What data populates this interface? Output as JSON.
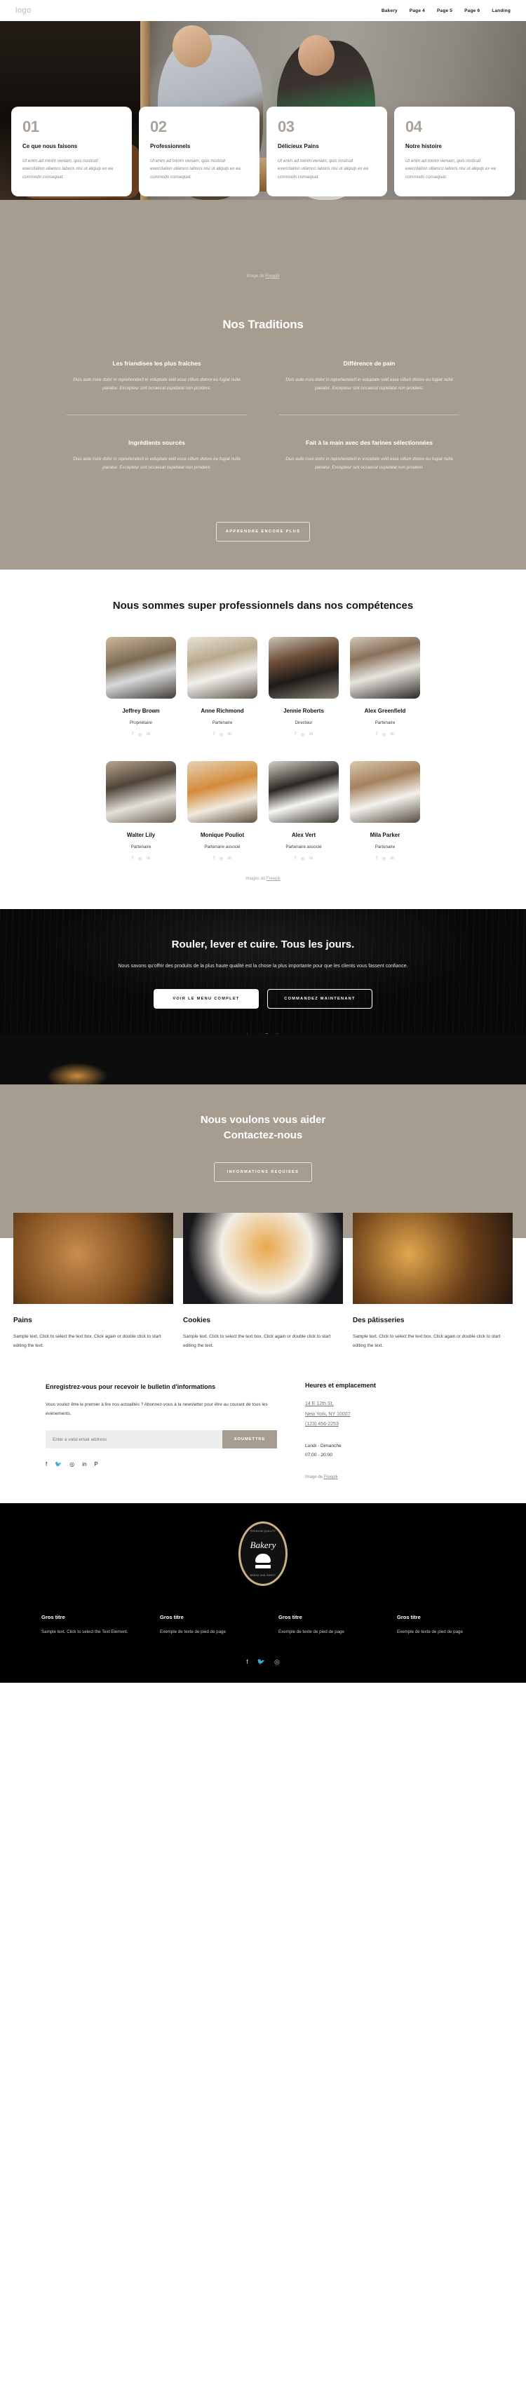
{
  "header": {
    "logo": "logo",
    "nav": [
      {
        "label": "Bakery"
      },
      {
        "label": "Page 4"
      },
      {
        "label": "Page 5"
      },
      {
        "label": "Page 6"
      },
      {
        "label": "Landing"
      }
    ]
  },
  "info_cards": [
    {
      "num": "01",
      "title": "Ce que nous faisons",
      "desc": "Ut enim ad minim veniam, quis nostrud exercitation ullamco laboris nisi ut aliquip ex ea commodo consequat."
    },
    {
      "num": "02",
      "title": "Professionnels",
      "desc": "Ut enim ad minim veniam, quis nostrud exercitation ullamco laboris nisi ut aliquip ex ea commodo consequat."
    },
    {
      "num": "03",
      "title": "Délicieux Pains",
      "desc": "Ut enim ad minim veniam, quis nostrud exercitation ullamco laboris nisi ut aliquip ex ea commodo consequat."
    },
    {
      "num": "04",
      "title": "Notre histoire",
      "desc": "Ut enim ad minim veniam, quis nostrud exercitation ullamco laboris nisi ut aliquip ex ea commodo consequat."
    }
  ],
  "credits": {
    "prefix": "Image de ",
    "link": "Freepik",
    "plural_prefix": "Images de "
  },
  "traditions": {
    "title": "Nos Traditions",
    "items": [
      {
        "title": "Les friandises les plus fraîches",
        "desc": "Duis aute irure dolor in reprehenderit in voluptate velit esse cillum dolore eu fugiat nulla pariatur. Excepteur sint occaecat cupidatat non proident."
      },
      {
        "title": "Différence de pain",
        "desc": "Duis aute irure dolor in reprehenderit in voluptate velit esse cillum dolore eu fugiat nulla pariatur. Excepteur sint occaecat cupidatat non proident."
      },
      {
        "title": "Ingrédients sourcés",
        "desc": "Duis aute irure dolor in reprehenderit in voluptate velit esse cillum dolore eu fugiat nulla pariatur. Excepteur sint occaecat cupidatat non proident."
      },
      {
        "title": "Fait à la main avec des farines sélectionnées",
        "desc": "Duis aute irure dolor in reprehenderit in voluptate velit esse cillum dolore eu fugiat nulla pariatur. Excepteur sint occaecat cupidatat non proident."
      }
    ],
    "button": "APPRENDRE ENCORE PLUS"
  },
  "team": {
    "title": "Nous sommes super professionnels dans nos compétences",
    "members": [
      {
        "name": "Jeffrey Brown",
        "role": "Propriétaire"
      },
      {
        "name": "Anne Richmond",
        "role": "Partenaire"
      },
      {
        "name": "Jennie Roberts",
        "role": "Directeur"
      },
      {
        "name": "Alex Greenfield",
        "role": "Partenaire"
      },
      {
        "name": "Walter Lily",
        "role": "Partenaire"
      },
      {
        "name": "Monique Pouliot",
        "role": "Partenaire associé"
      },
      {
        "name": "Alex Vert",
        "role": "Partenaire associé"
      },
      {
        "name": "Mila Parker",
        "role": "Partenaire"
      }
    ],
    "social_icons": [
      "facebook-icon",
      "instagram-icon",
      "linkedin-icon"
    ]
  },
  "cta": {
    "title": "Rouler, lever et cuire. Tous les jours.",
    "text": "Nous savons qu'offrir des produits de la plus haute qualité est la chose la plus importante pour que les clients vous fassent confiance.",
    "primary_button": "VOIR LE MENU COMPLET",
    "secondary_button": "COMMANDEZ MAINTENANT"
  },
  "contact": {
    "line1": "Nous voulons vous aider",
    "line2": "Contactez-nous",
    "button": "INFORMATIONS REQUISES"
  },
  "products": [
    {
      "title": "Pains",
      "text": "Sample text. Click to select the text box. Click again or double click to start editing the text."
    },
    {
      "title": "Cookies",
      "text": "Sample text. Click to select the text box. Click again or double click to start editing the text."
    },
    {
      "title": "Des pâtisseries",
      "text": "Sample text. Click to select the text box. Click again or double click to start editing the text."
    }
  ],
  "newsletter": {
    "title": "Enregistrez-vous pour recevoir le bulletin d'informations",
    "text": "Vous voulez être le premier à lire nos actualités ? Abonnez-vous à la newsletter pour être au courant de tous les événements.",
    "placeholder": "Enter a valid email address",
    "submit": "SOUMETTRE",
    "social_icons": [
      "facebook-icon",
      "twitter-icon",
      "instagram-icon",
      "linkedin-icon",
      "pinterest-icon"
    ]
  },
  "hours": {
    "title": "Heures et emplacement",
    "address_line1": "14 E 12th St,",
    "address_line2": "New York, NY 10007",
    "phone": "(123) 456-2253",
    "days": "Lundi - Dimanche",
    "time": "07:00 - 20:00"
  },
  "footer": {
    "badge": {
      "top_text": "PREMIUM QUALITY",
      "name": "Bakery",
      "mid_text": "SINCE 1930",
      "bottom_text": "BREAD AND SWEET"
    },
    "columns": [
      {
        "title": "Gros titre",
        "text": "Sample text. Click to select the Text Element."
      },
      {
        "title": "Gros titre",
        "text": "Exemple de texte de pied de page"
      },
      {
        "title": "Gros titre",
        "text": "Exemple de texte de pied de page"
      },
      {
        "title": "Gros titre",
        "text": "Exemple de texte de pied de page"
      }
    ],
    "social_icons": [
      "facebook-icon",
      "twitter-icon",
      "instagram-icon"
    ]
  },
  "colors": {
    "accent": "#a69d90",
    "dark": "#0d0d0e",
    "text": "#141414"
  }
}
